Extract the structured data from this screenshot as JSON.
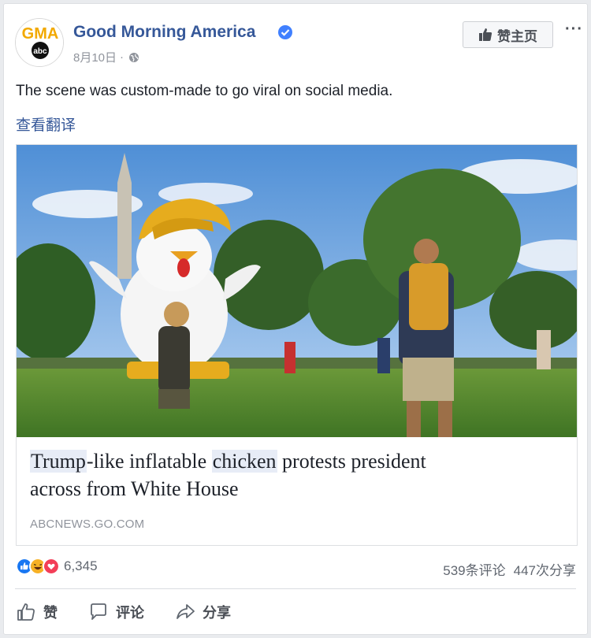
{
  "post": {
    "page_name": "Good Morning America",
    "date": "8月10日",
    "separator": "·",
    "like_page_label": "赞主页",
    "more_label": "···",
    "text": "The scene was custom-made to go viral on social media.",
    "translate_label": "查看翻译"
  },
  "avatar": {
    "logo_text": "GMA",
    "sub_text": "abc"
  },
  "link": {
    "title_hl1": "Trump",
    "title_mid1": "-like inflatable ",
    "title_hl2": "chicken",
    "title_mid2": " protests president",
    "title_line2": "across from White House",
    "source": "ABCNEWS.GO.COM"
  },
  "stats": {
    "reaction_count": "6,345",
    "comments": "539条评论",
    "shares": "447次分享"
  },
  "actions": {
    "like": "赞",
    "comment": "评论",
    "share": "分享"
  },
  "colors": {
    "brand_blue": "#365899",
    "like_blue": "#1877f2",
    "haha_yellow": "#f7b125",
    "love_red": "#f33e58",
    "gold": "#e6ac1e"
  },
  "icons": [
    "verified-badge-icon",
    "globe-icon",
    "thumbs-up-icon",
    "speech-bubble-icon",
    "share-arrow-icon",
    "like-reaction-icon",
    "haha-reaction-icon",
    "love-reaction-icon"
  ]
}
